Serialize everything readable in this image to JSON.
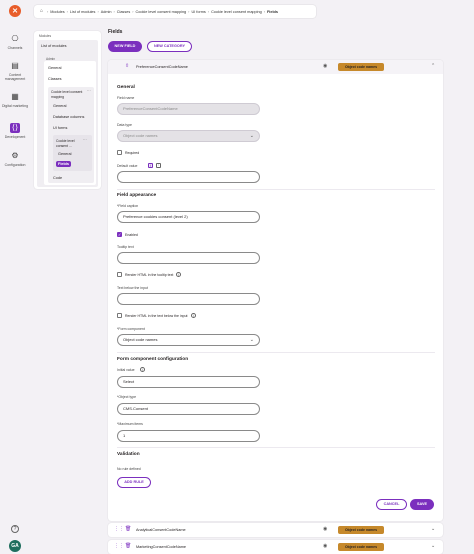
{
  "rail": {
    "logo": "✕",
    "items": [
      {
        "label": "Channels",
        "icon": "channels-icon"
      },
      {
        "label": "Content management",
        "icon": "content-icon"
      },
      {
        "label": "Digital marketing",
        "icon": "marketing-icon"
      },
      {
        "label": "Development",
        "icon": "code-icon"
      },
      {
        "label": "Configuration",
        "icon": "gear-icon"
      }
    ],
    "help": "?",
    "avatar": "GA"
  },
  "breadcrumb": [
    "Modules",
    "List of modules",
    "Admin",
    "Classes",
    "Cookie level consent mapping",
    "UI forms",
    "Cookie level consent mapping",
    "Fields"
  ],
  "tree": {
    "section_label": "Modules",
    "list_of_modules": "List of modules",
    "admin_label": "Admin",
    "general": "General",
    "classes": "Classes",
    "class_item": "Cookie level consent mapping",
    "class_general": "General",
    "database_columns": "Database columns",
    "ui_forms": "UI forms",
    "form_item": "Cookie level consent ...",
    "form_general": "General",
    "fields": "Fields",
    "code": "Code"
  },
  "main": {
    "title": "Fields",
    "new_field": "NEW FIELD",
    "new_category": "NEW CATEGORY"
  },
  "open_field": {
    "name": "PreferenceConsentCodeName",
    "badge": "Object code names",
    "general_heading": "General",
    "field_name_label": "Field name",
    "field_name_value": "PreferenceConsentCodeName",
    "data_type_label": "Data type",
    "data_type_placeholder": "Object code names",
    "required_label": "Required",
    "default_value_label": "Default value",
    "field_appearance_heading": "Field appearance",
    "field_caption_label": "*Field caption",
    "field_caption_value": "Preference cookies consent (level 2)",
    "enabled_label": "Enabled",
    "tooltip_label": "Tooltip text",
    "tooltip_value": "",
    "render_html_tooltip": "Render HTML in the tooltip text",
    "text_below_label": "Text below the input",
    "text_below_value": "",
    "render_html_below": "Render HTML in the text below the input",
    "form_component_label": "*Form component",
    "form_component_value": "Object code names",
    "form_component_config_heading": "Form component configuration",
    "initial_value_label": "Initial value",
    "initial_value": "Select",
    "object_type_label": "*Object type",
    "object_type_value": "CMS.Consent",
    "maximum_items_label": "*Maximum items",
    "maximum_items_value": "1",
    "validation_heading": "Validation",
    "no_rule": "No rule defined",
    "add_rule": "ADD RULE",
    "cancel": "CANCEL",
    "save": "SAVE"
  },
  "other_fields": [
    {
      "name": "AnalyticalConsentCodeName",
      "badge": "Object code names"
    },
    {
      "name": "MarketingConsentCodeName",
      "badge": "Object code names"
    }
  ],
  "colors": {
    "accent": "#7b2fbe",
    "badge": "#c6892b",
    "logo": "#e85d2a"
  }
}
